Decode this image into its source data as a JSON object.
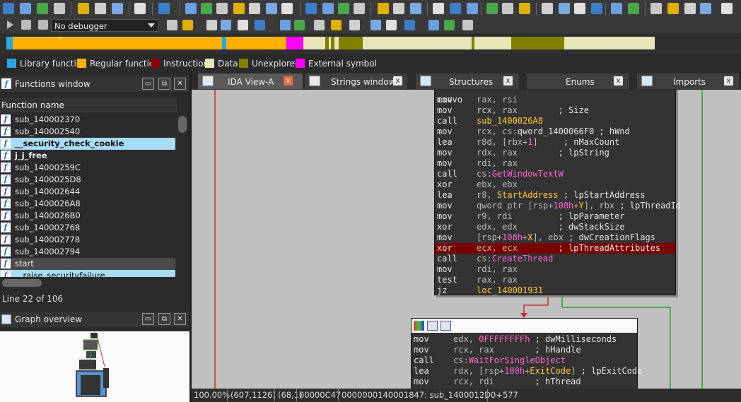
{
  "toolbar": {
    "debugger_select": "No debugger"
  },
  "legend": {
    "items": [
      {
        "label": "Library function",
        "color": "#29a8e0"
      },
      {
        "label": "Regular function",
        "color": "#ffb000"
      },
      {
        "label": "Instruction",
        "color": "#8b0000"
      },
      {
        "label": "Data",
        "color": "#e8e6b8"
      },
      {
        "label": "Unexplored",
        "color": "#808000"
      },
      {
        "label": "External symbol",
        "color": "#ff00ff"
      }
    ]
  },
  "functions_window": {
    "title": "Functions window",
    "column_header": "Function name",
    "rows": [
      {
        "name": "sub_140002370",
        "bold": false,
        "selected": false
      },
      {
        "name": "sub_140002540",
        "bold": false,
        "selected": false
      },
      {
        "name": "__security_check_cookie",
        "bold": true,
        "selected": true
      },
      {
        "name": "j_j_free",
        "bold": true,
        "selected": false
      },
      {
        "name": "sub_14000259C",
        "bold": false,
        "selected": false
      },
      {
        "name": "sub_1400025D8",
        "bold": false,
        "selected": false
      },
      {
        "name": "sub_140002644",
        "bold": false,
        "selected": false
      },
      {
        "name": "sub_1400026A8",
        "bold": false,
        "selected": false
      },
      {
        "name": "sub_1400026B0",
        "bold": false,
        "selected": false
      },
      {
        "name": "sub_140002768",
        "bold": false,
        "selected": false
      },
      {
        "name": "sub_140002778",
        "bold": false,
        "selected": false
      },
      {
        "name": "sub_140002794",
        "bold": false,
        "selected": false
      },
      {
        "name": "start",
        "bold": false,
        "selected": false,
        "highlight": true
      },
      {
        "name": "__raise_securityfailure",
        "bold": false,
        "selected": true,
        "partial": true
      }
    ],
    "line_status": "Line 22 of 106"
  },
  "graph_overview": {
    "title": "Graph overview"
  },
  "tabs": [
    {
      "label": "IDA View-A",
      "active": true,
      "close": "x"
    },
    {
      "label": "Strings window",
      "active": false,
      "close": "x"
    },
    {
      "label": "Structures",
      "active": false,
      "close": "x"
    },
    {
      "label": "Enums",
      "active": false,
      "close": "x"
    },
    {
      "label": "Imports",
      "active": false,
      "close": "x"
    }
  ],
  "block1": {
    "partial_top": {
      "mnem": "mov",
      "ops": "rcx"
    },
    "lines": [
      {
        "mnem": "cmovo",
        "ops": [
          {
            "t": "rax, rsi",
            "c": "gr"
          }
        ],
        "comment": ""
      },
      {
        "mnem": "mov",
        "ops": [
          {
            "t": "rcx, rax",
            "c": "gr"
          }
        ],
        "comment": "        ; Size"
      },
      {
        "mnem": "call",
        "ops": [
          {
            "t": "sub_1400026A8",
            "c": "y"
          }
        ],
        "comment": ""
      },
      {
        "mnem": "mov",
        "ops": [
          {
            "t": "rcx, cs:",
            "c": "gr"
          },
          {
            "t": "qword_1400066F0",
            "c": "wh"
          }
        ],
        "comment": " ; hWnd"
      },
      {
        "mnem": "lea",
        "ops": [
          {
            "t": "r8d, [rbx+",
            "c": "gr"
          },
          {
            "t": "1",
            "c": "p"
          },
          {
            "t": "]",
            "c": "gr"
          }
        ],
        "comment": "     ; nMaxCount"
      },
      {
        "mnem": "mov",
        "ops": [
          {
            "t": "rdx, rax",
            "c": "gr"
          }
        ],
        "comment": "        ; lpString"
      },
      {
        "mnem": "mov",
        "ops": [
          {
            "t": "rdi, rax",
            "c": "gr"
          }
        ],
        "comment": ""
      },
      {
        "mnem": "call",
        "ops": [
          {
            "t": "cs:",
            "c": "gr"
          },
          {
            "t": "GetWindowTextW",
            "c": "p"
          }
        ],
        "comment": ""
      },
      {
        "mnem": "xor",
        "ops": [
          {
            "t": "ebx, ebx",
            "c": "gr"
          }
        ],
        "comment": ""
      },
      {
        "mnem": "lea",
        "ops": [
          {
            "t": "r8, ",
            "c": "gr"
          },
          {
            "t": "StartAddress",
            "c": "y"
          }
        ],
        "comment": " ; lpStartAddress"
      },
      {
        "mnem": "mov",
        "ops": [
          {
            "t": "qword ptr [rsp+",
            "c": "gr"
          },
          {
            "t": "108h",
            "c": "p"
          },
          {
            "t": "+",
            "c": "gr"
          },
          {
            "t": "Y",
            "c": "y"
          },
          {
            "t": "], rbx",
            "c": "gr"
          }
        ],
        "comment": " ; lpThreadId"
      },
      {
        "mnem": "mov",
        "ops": [
          {
            "t": "r9, rdi",
            "c": "gr"
          }
        ],
        "comment": "         ; lpParameter"
      },
      {
        "mnem": "xor",
        "ops": [
          {
            "t": "edx, edx",
            "c": "gr"
          }
        ],
        "comment": "        ; dwStackSize"
      },
      {
        "mnem": "mov",
        "ops": [
          {
            "t": "[rsp+",
            "c": "gr"
          },
          {
            "t": "108h",
            "c": "p"
          },
          {
            "t": "+",
            "c": "gr"
          },
          {
            "t": "X",
            "c": "y"
          },
          {
            "t": "], ebx",
            "c": "gr"
          }
        ],
        "comment": " ; dwCreationFlags"
      },
      {
        "mnem": "xor",
        "ops": [
          {
            "t": "ecx, ecx",
            "c": "gr"
          }
        ],
        "comment": "        ; lpThreadAttributes",
        "highlight": true
      },
      {
        "mnem": "call",
        "ops": [
          {
            "t": "cs:",
            "c": "gr"
          },
          {
            "t": "CreateThread",
            "c": "p"
          }
        ],
        "comment": ""
      },
      {
        "mnem": "mov",
        "ops": [
          {
            "t": "rdi, rax",
            "c": "gr"
          }
        ],
        "comment": ""
      },
      {
        "mnem": "test",
        "ops": [
          {
            "t": "rax, rax",
            "c": "gr"
          }
        ],
        "comment": ""
      },
      {
        "mnem": "jz",
        "ops": [
          {
            "t": "loc_140001931",
            "c": "y"
          }
        ],
        "comment": ""
      }
    ]
  },
  "block2": {
    "lines": [
      {
        "mnem": "mov",
        "ops": [
          {
            "t": "edx, ",
            "c": "gr"
          },
          {
            "t": "0FFFFFFFFh",
            "c": "p"
          }
        ],
        "comment": " ; dwMilliseconds"
      },
      {
        "mnem": "mov",
        "ops": [
          {
            "t": "rcx, rax",
            "c": "gr"
          }
        ],
        "comment": "        ; hHandle"
      },
      {
        "mnem": "call",
        "ops": [
          {
            "t": "cs:",
            "c": "gr"
          },
          {
            "t": "WaitForSingleObject",
            "c": "p"
          }
        ],
        "comment": ""
      },
      {
        "mnem": "lea",
        "ops": [
          {
            "t": "rdx, [rsp+",
            "c": "gr"
          },
          {
            "t": "108h",
            "c": "p"
          },
          {
            "t": "+",
            "c": "gr"
          },
          {
            "t": "ExitCode",
            "c": "y"
          },
          {
            "t": "]",
            "c": "gr"
          }
        ],
        "comment": " ; lpExitCode"
      },
      {
        "mnem": "mov",
        "ops": [
          {
            "t": "rcx, rdi",
            "c": "gr"
          }
        ],
        "comment": "        ; hThread"
      }
    ]
  },
  "status_bar": {
    "zoom": "100.00%",
    "coords1": "(607,1126)",
    "coords2": "(68,1)",
    "offset": "00000C47",
    "address": "0000000140001847: sub_1400012D0+577"
  }
}
